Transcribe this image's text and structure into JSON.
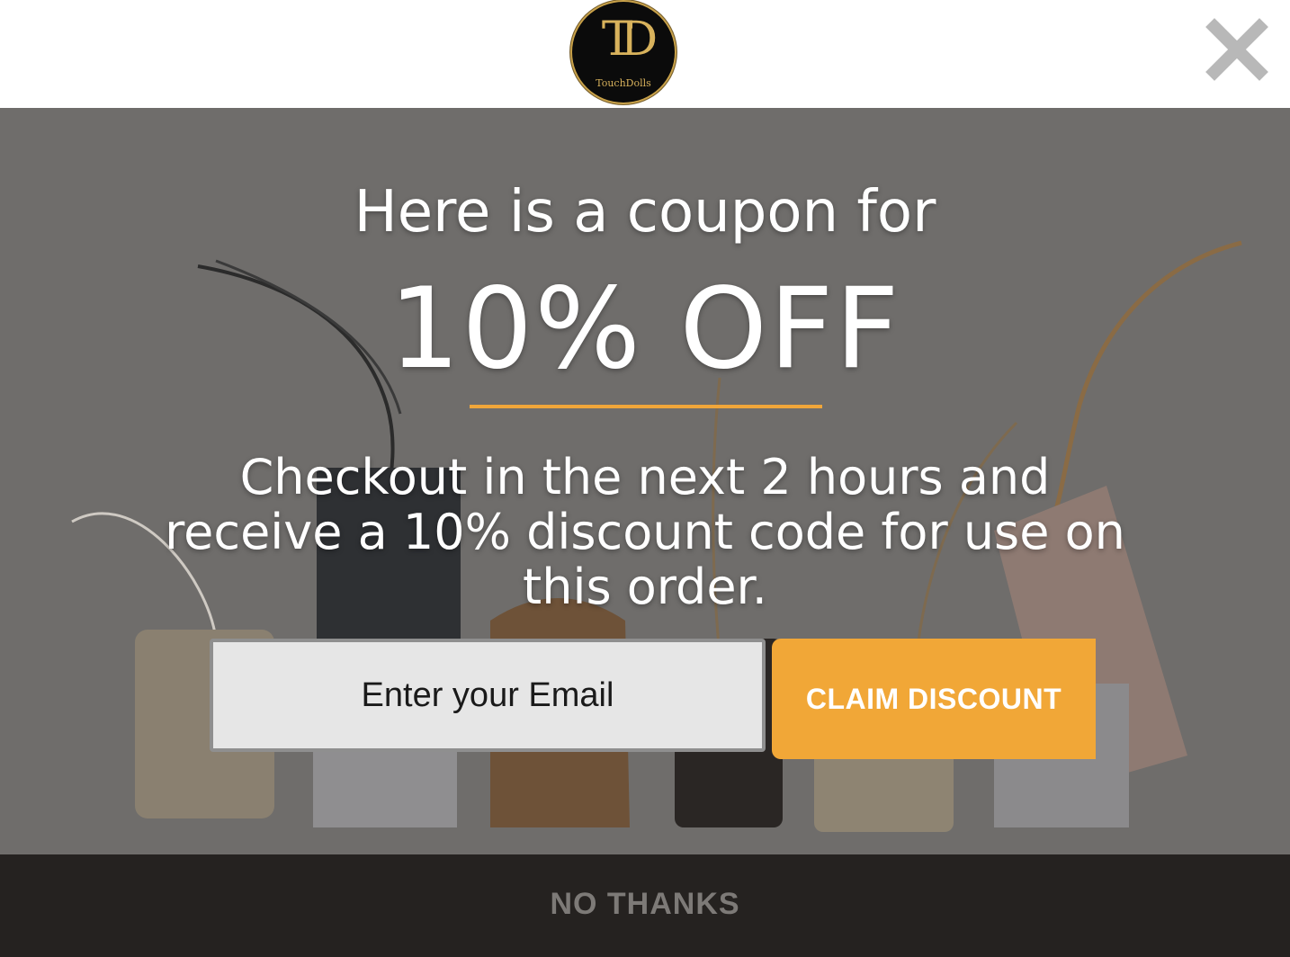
{
  "brand": {
    "logo_monogram": "TD",
    "logo_text": "TouchDolls"
  },
  "popup": {
    "headline_line1": "Here is a coupon for",
    "headline_offer": "10% OFF",
    "body": "Checkout in the next 2 hours and receive a 10% discount code for use on this order.",
    "email": {
      "placeholder": "Enter your Email",
      "value": ""
    },
    "claim_label": "CLAIM DISCOUNT",
    "decline_label": "NO THANKS"
  },
  "icons": {
    "close": "close-icon"
  },
  "colors": {
    "accent": "#f1a737",
    "overlay": "#6f6d6b",
    "footer_bg": "#252220",
    "footer_text": "#7d7a77",
    "logo_gold": "#d8b25c",
    "close_icon": "#b8b8b8"
  }
}
